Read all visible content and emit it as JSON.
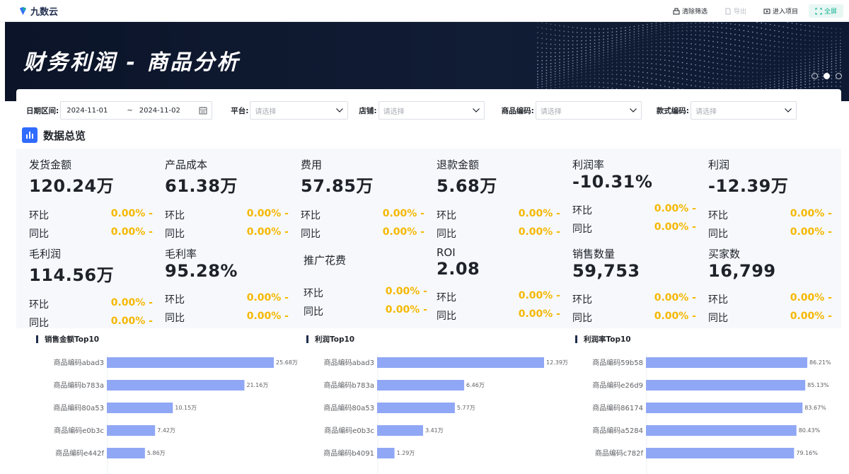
{
  "app": {
    "logo": "九数云"
  },
  "topbar": {
    "clear_filters": "清除筛选",
    "export": "导出",
    "enter_project": "进入项目",
    "fullscreen": "全屏"
  },
  "banner": {
    "title": "财务利润 - 商品分析"
  },
  "filters": {
    "date_label": "日期区间:",
    "date_start": "2024-11-01",
    "date_sep": "~",
    "date_end": "2024-11-02",
    "platform_label": "平台:",
    "store_label": "店铺:",
    "code_label": "商品编码:",
    "style_label": "款式编码:",
    "placeholder": "请选择"
  },
  "overview": {
    "title": "数据总览"
  },
  "metrics": [
    {
      "name": "发货金额",
      "value": "120.24万",
      "rows": [
        {
          "label": "环比",
          "pct": "0.00% -"
        },
        {
          "label": "同比",
          "pct": "0.00% -"
        }
      ]
    },
    {
      "name": "产品成本",
      "value": "61.38万",
      "rows": [
        {
          "label": "环比",
          "pct": "0.00% -"
        },
        {
          "label": "同比",
          "pct": "0.00% -"
        }
      ]
    },
    {
      "name": "费用",
      "value": "57.85万",
      "rows": [
        {
          "label": "环比",
          "pct": "0.00% -"
        },
        {
          "label": "同比",
          "pct": "0.00% -"
        }
      ]
    },
    {
      "name": "退款金额",
      "value": "5.68万",
      "rows": [
        {
          "label": "环比",
          "pct": "0.00% -"
        },
        {
          "label": "同比",
          "pct": "0.00% -"
        }
      ]
    },
    {
      "name": "利润率",
      "value": "-10.31%",
      "rows": [
        {
          "label": "环比",
          "pct": "0.00% -"
        },
        {
          "label": "同比",
          "pct": "0.00% -"
        }
      ]
    },
    {
      "name": "利润",
      "value": "-12.39万",
      "rows": [
        {
          "label": "环比",
          "pct": "0.00% -"
        },
        {
          "label": "同比",
          "pct": "0.00% -"
        }
      ]
    },
    {
      "name": "毛利润",
      "value": "114.56万",
      "rows": [
        {
          "label": "环比",
          "pct": "0.00% -"
        },
        {
          "label": "同比",
          "pct": "0.00% -"
        }
      ]
    },
    {
      "name": "毛利率",
      "value": "95.28%",
      "rows": [
        {
          "label": "环比",
          "pct": "0.00% -"
        },
        {
          "label": "同比",
          "pct": "0.00% -"
        }
      ]
    },
    {
      "name": "推广花费",
      "value": "",
      "rows": [
        {
          "label": "环比",
          "pct": "0.00% -"
        },
        {
          "label": "同比",
          "pct": "0.00% -"
        }
      ]
    },
    {
      "name": "ROI",
      "value": "2.08",
      "rows": [
        {
          "label": "环比",
          "pct": "0.00% -"
        },
        {
          "label": "同比",
          "pct": "0.00% -"
        }
      ]
    },
    {
      "name": "销售数量",
      "value": "59,753",
      "rows": [
        {
          "label": "环比",
          "pct": "0.00% -"
        },
        {
          "label": "同比",
          "pct": "0.00% -"
        }
      ]
    },
    {
      "name": "买家数",
      "value": "16,799",
      "rows": [
        {
          "label": "环比",
          "pct": "0.00% -"
        },
        {
          "label": "同比",
          "pct": "0.00% -"
        }
      ]
    }
  ],
  "colors": {
    "bar": "#8fa7f5",
    "accent": "#2f6bff",
    "pct": "#f5b800",
    "fullscreen": "#1ab394"
  },
  "chart_data": [
    {
      "type": "bar",
      "title": "销售金额Top10",
      "categories": [
        "商品编码abad3",
        "商品编码b783a",
        "商品编码80a53",
        "商品编码e0b3c",
        "商品编码e442f"
      ],
      "values": [
        25.68,
        21.16,
        10.15,
        7.42,
        5.86
      ],
      "labels": [
        "25.68万",
        "21.16万",
        "10.15万",
        "7.42万",
        "5.86万"
      ],
      "orientation": "horizontal"
    },
    {
      "type": "bar",
      "title": "利润Top10",
      "categories": [
        "商品编码abad3",
        "商品编码b783a",
        "商品编码80a53",
        "商品编码e0b3c",
        "商品编码b4091"
      ],
      "values": [
        12.39,
        6.46,
        5.77,
        3.41,
        1.29
      ],
      "labels": [
        "12.39万",
        "6.46万",
        "5.77万",
        "3.41万",
        "1.29万"
      ],
      "orientation": "horizontal"
    },
    {
      "type": "bar",
      "title": "利润率Top10",
      "categories": [
        "商品编码59b58",
        "商品编码e26d9",
        "商品编码86174",
        "商品编码a5284",
        "商品编码c782f"
      ],
      "values": [
        86.21,
        85.13,
        83.67,
        80.43,
        79.16
      ],
      "labels": [
        "86.21%",
        "85.13%",
        "83.67%",
        "80.43%",
        "79.16%"
      ],
      "orientation": "horizontal"
    }
  ]
}
